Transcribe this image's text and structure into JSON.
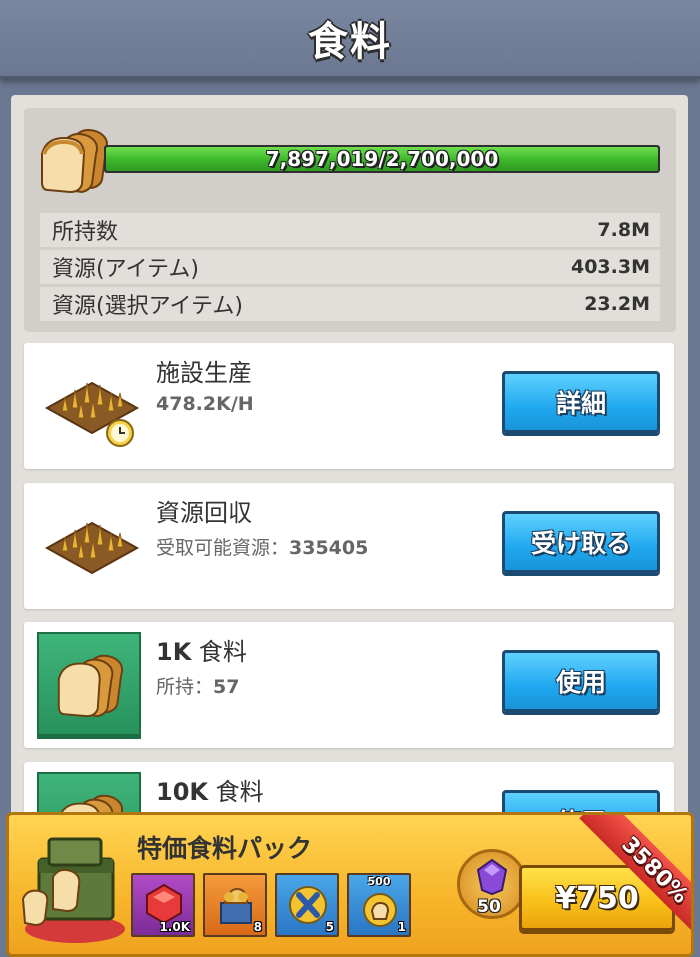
{
  "header": {
    "title": "食料"
  },
  "summary": {
    "progress_text": "7,897,019/2,700,000",
    "progress_fraction": 1.0,
    "rows": [
      {
        "label": "所持数",
        "value": "7.8M"
      },
      {
        "label": "資源(アイテム)",
        "value": "403.3M"
      },
      {
        "label": "資源(選択アイテム)",
        "value": "23.2M"
      }
    ]
  },
  "cards": [
    {
      "title": "施設生産",
      "sub": "478.2K/H",
      "button": "詳細",
      "icon": "wheat-field-clock-icon"
    },
    {
      "title": "資源回収",
      "sub_label": "受取可能資源：",
      "sub_value": "335405",
      "button": "受け取る",
      "icon": "wheat-field-icon"
    },
    {
      "title_bold": "1K",
      "title_rest": " 食料",
      "sub_label": "所持：",
      "sub_value": "57",
      "button": "使用",
      "icon": "bread-icon"
    },
    {
      "title_bold": "10K",
      "title_rest": " 食料",
      "button": "使用",
      "icon": "bread-icon"
    }
  ],
  "offer": {
    "title": "特価食料パック",
    "rewards": [
      {
        "icon": "ruby-icon",
        "count": "1.0K"
      },
      {
        "icon": "bread-crate-icon",
        "count": "8"
      },
      {
        "icon": "speedup-x-icon",
        "count": "5"
      },
      {
        "icon": "bread-token-icon",
        "count": "1",
        "top_label": "500"
      }
    ],
    "gem_count": "50",
    "price": "¥750",
    "ribbon": "3580%"
  },
  "colors": {
    "background": "#6b7891",
    "progress_green": "#3cb52b",
    "button_blue": "#20a8f0",
    "offer_yellow": "#f7b52a",
    "ribbon_red": "#c92a26"
  }
}
